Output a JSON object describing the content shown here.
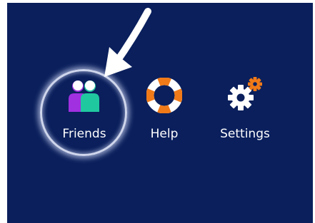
{
  "menu": {
    "items": [
      {
        "label": "Friends",
        "icon": "friends-icon",
        "highlighted": true
      },
      {
        "label": "Help",
        "icon": "life-ring-icon",
        "highlighted": false
      },
      {
        "label": "Settings",
        "icon": "gears-icon",
        "highlighted": false
      }
    ]
  },
  "colors": {
    "background": "#0a1f5c",
    "text": "#ffffff",
    "friend_purple": "#a030e0",
    "friend_teal": "#20c8a0",
    "help_orange": "#f07a18",
    "settings_orange": "#f07a18",
    "highlight": "#cfd6ec"
  }
}
